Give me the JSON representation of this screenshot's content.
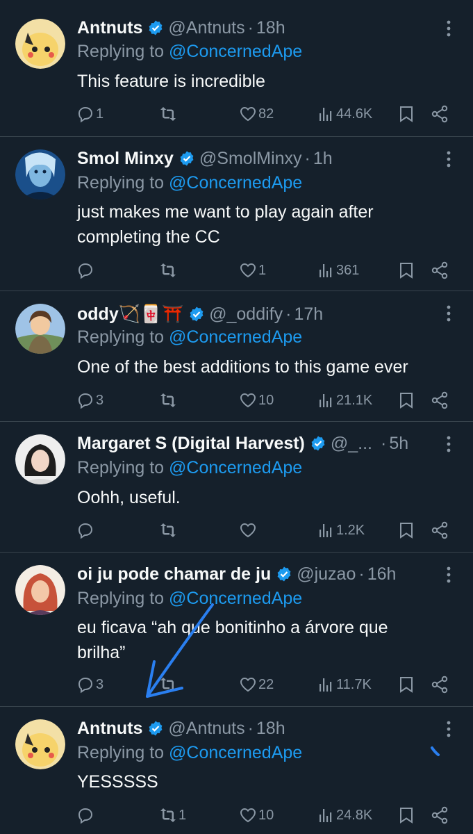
{
  "tweets": [
    {
      "name": "Antnuts",
      "handle": "@Antnuts",
      "time": "18h",
      "replying_prefix": "Replying to ",
      "replying_to": "@ConcernedApe",
      "text": "This feature is incredible",
      "replies": "1",
      "reposts": "",
      "likes": "82",
      "views": "44.6K",
      "avatar": "pikachu-avatar"
    },
    {
      "name": "Smol Minxy",
      "handle": "@SmolMinxy",
      "time": "1h",
      "replying_prefix": "Replying to ",
      "replying_to": "@ConcernedApe",
      "text": "just makes me want to play again after completing the CC",
      "replies": "",
      "reposts": "",
      "likes": "1",
      "views": "361",
      "avatar": "blue-portrait-avatar"
    },
    {
      "name": "oddy🏹🀄⛩️",
      "handle": "@_oddify",
      "time": "17h",
      "replying_prefix": "Replying to ",
      "replying_to": "@ConcernedApe",
      "text": "One of the best additions to this game ever",
      "replies": "3",
      "reposts": "",
      "likes": "10",
      "views": "21.1K",
      "avatar": "anime-character-avatar"
    },
    {
      "name": "Margaret S (Digital Harvest)",
      "handle": "@_...",
      "time": "5h",
      "replying_prefix": "Replying to ",
      "replying_to": "@ConcernedApe",
      "text": "Oohh, useful.",
      "replies": "",
      "reposts": "",
      "likes": "",
      "views": "1.2K",
      "avatar": "woman-photo-avatar"
    },
    {
      "name": "oi ju pode chamar de ju",
      "handle": "@juzao",
      "time": "16h",
      "replying_prefix": "Replying to ",
      "replying_to": "@ConcernedApe",
      "text": "eu ficava “ah que bonitinho a árvore que brilha”",
      "replies": "3",
      "reposts": "",
      "likes": "22",
      "views": "11.7K",
      "avatar": "red-hair-avatar"
    },
    {
      "name": "Antnuts",
      "handle": "@Antnuts",
      "time": "18h",
      "replying_prefix": "Replying to ",
      "replying_to": "@ConcernedApe",
      "text": "YESSSSS",
      "replies": "",
      "reposts": "1",
      "likes": "10",
      "views": "24.8K",
      "avatar": "pikachu-avatar"
    }
  ],
  "colors": {
    "background": "#15202b",
    "text": "#f7f9f9",
    "muted": "#8b98a5",
    "accent": "#1d9bf0",
    "divider": "#38444d",
    "annotation_arrow": "#2a7ff0"
  }
}
